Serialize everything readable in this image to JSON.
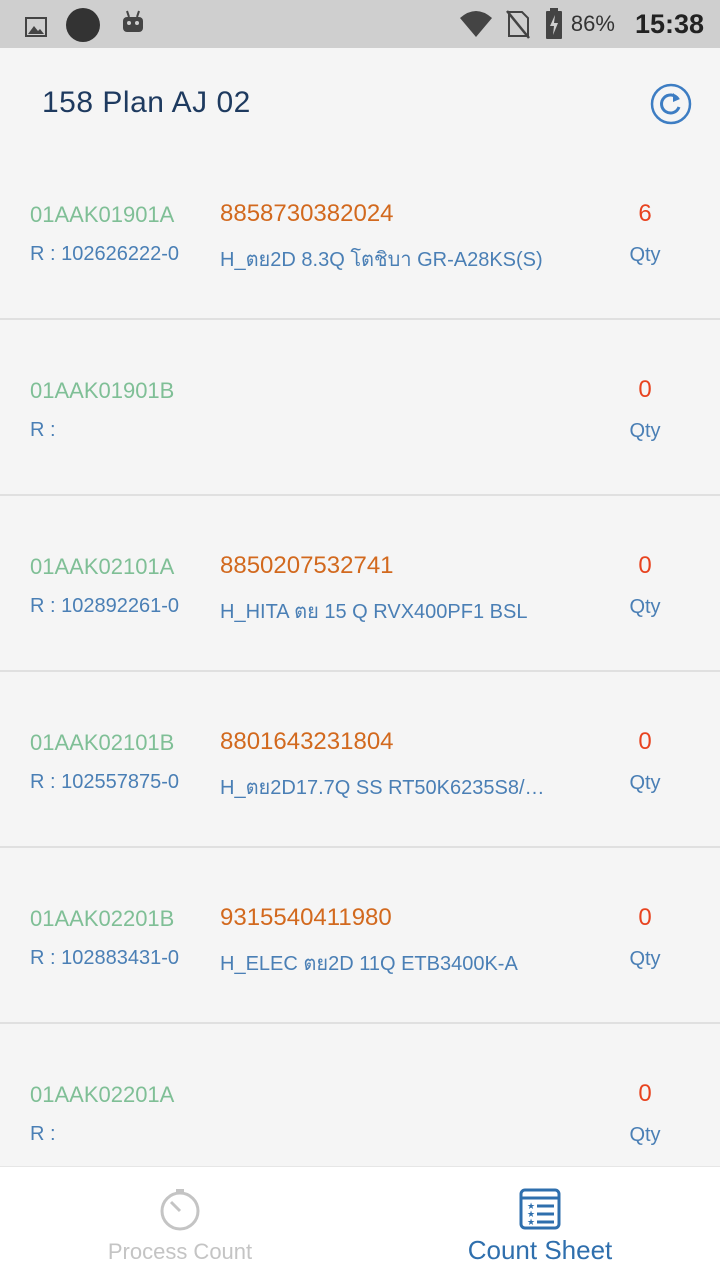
{
  "status_bar": {
    "battery": "86%",
    "time": "15:38",
    "icons": [
      "image-icon",
      "circle-icon",
      "android-icon",
      "wifi-icon",
      "no-sim-icon",
      "battery-charging-icon"
    ]
  },
  "header": {
    "title": "158 Plan AJ 02",
    "refresh_icon": "refresh-icon"
  },
  "items": [
    {
      "location": "01AAK01901A",
      "ref": "R : 102626222-0",
      "barcode": "8858730382024",
      "description": "H_ตย2D 8.3Q โตชิบา GR-A28KS(S)",
      "qty": "6",
      "qty_label": "Qty"
    },
    {
      "location": "01AAK01901B",
      "ref": "R :",
      "barcode": "",
      "description": "",
      "qty": "0",
      "qty_label": "Qty"
    },
    {
      "location": "01AAK02101A",
      "ref": "R : 102892261-0",
      "barcode": "8850207532741",
      "description": "H_HITA ตย 15 Q RVX400PF1 BSL",
      "qty": "0",
      "qty_label": "Qty"
    },
    {
      "location": "01AAK02101B",
      "ref": "R : 102557875-0",
      "barcode": "8801643231804",
      "description": "H_ตย2D17.7Q SS RT50K6235S8/…",
      "qty": "0",
      "qty_label": "Qty"
    },
    {
      "location": "01AAK02201B",
      "ref": "R : 102883431-0",
      "barcode": "9315540411980",
      "description": "H_ELEC ตย2D 11Q ETB3400K-A",
      "qty": "0",
      "qty_label": "Qty"
    },
    {
      "location": "01AAK02201A",
      "ref": "R :",
      "barcode": "",
      "description": "",
      "qty": "0",
      "qty_label": "Qty"
    }
  ],
  "bottom_nav": {
    "process_count": "Process Count",
    "count_sheet": "Count Sheet"
  },
  "colors": {
    "location": "#7fbf96",
    "barcode": "#d2691e",
    "qty": "#e8431f",
    "link": "#4a7fb5",
    "active_nav": "#2f6fad",
    "inactive_nav": "#c4c4c4"
  }
}
